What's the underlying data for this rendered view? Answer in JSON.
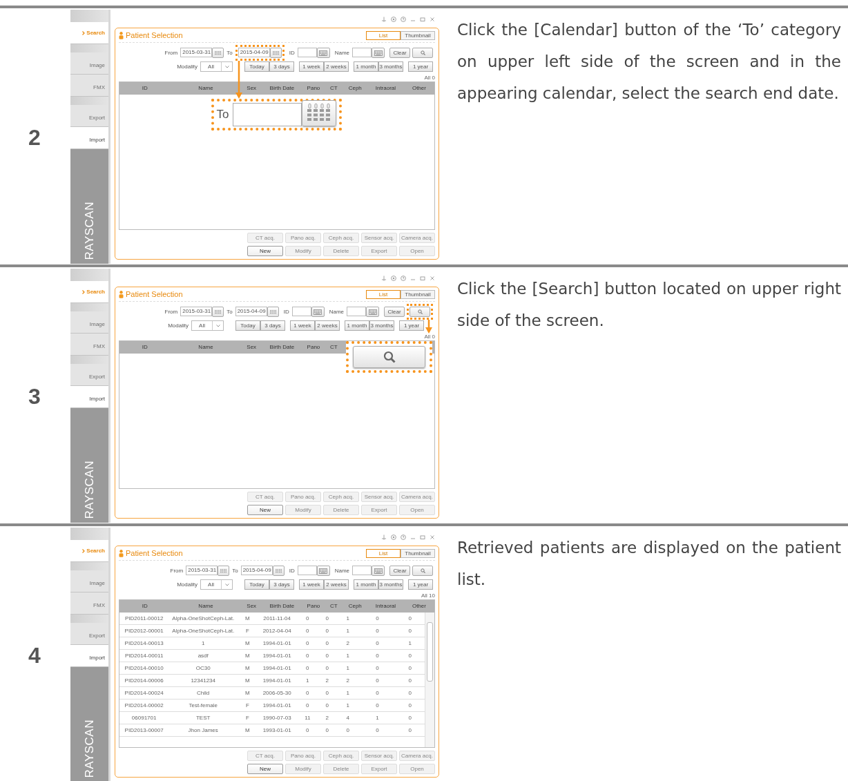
{
  "steps": [
    {
      "number": "2",
      "description": "Click the [Calendar] button of the ‘To’ category on upper left side of the screen and in the appearing calendar, select the search end date.",
      "screen": {
        "sidebar": [
          {
            "label": "Search",
            "selected": true,
            "disabled": false
          },
          {
            "label": "Image",
            "selected": false,
            "disabled": true
          },
          {
            "label": "FMX",
            "selected": false,
            "disabled": true
          },
          {
            "label": "Export",
            "selected": false,
            "disabled": true
          },
          {
            "label": "Import",
            "selected": false,
            "disabled": false
          }
        ],
        "brand": "RAYSCAN",
        "title": "Patient Selection",
        "views": [
          {
            "label": "List",
            "selected": true
          },
          {
            "label": "Thumbnail",
            "selected": false
          }
        ],
        "from_label": "From",
        "from_value": "2015-03-31",
        "to_label": "To",
        "to_value": "2015-04-09",
        "id_label": "ID",
        "name_label": "Name",
        "clear": "Clear",
        "modality_label": "Modality",
        "modality_value": "All",
        "ranges": [
          [
            "Today",
            "3 days"
          ],
          [
            "1 week",
            "2 weeks"
          ],
          [
            "1 month",
            "3 months"
          ],
          [
            "1 year"
          ]
        ],
        "count": "All 0",
        "columns": [
          "ID",
          "Name",
          "Sex",
          "Birth Date",
          "Pano",
          "CT",
          "Ceph",
          "Intraoral",
          "Other"
        ],
        "acq_buttons": [
          {
            "label": "CT acq.",
            "disabled": true
          },
          {
            "label": "Pano acq.",
            "disabled": true
          },
          {
            "label": "Ceph acq.",
            "disabled": true
          },
          {
            "label": "Sensor acq.",
            "disabled": true
          },
          {
            "label": "Camera acq.",
            "disabled": true
          }
        ],
        "action_buttons": [
          {
            "label": "New",
            "disabled": false
          },
          {
            "label": "Modify",
            "disabled": true
          },
          {
            "label": "Delete",
            "disabled": true
          },
          {
            "label": "Export",
            "disabled": true
          },
          {
            "label": "Open",
            "disabled": true
          }
        ],
        "callout": {
          "kind": "date",
          "label": "To"
        }
      }
    },
    {
      "number": "3",
      "description": "Click the [Search] button located on upper right side of the screen.",
      "screen": {
        "sidebar": [
          {
            "label": "Search",
            "selected": true,
            "disabled": false
          },
          {
            "label": "Image",
            "selected": false,
            "disabled": true
          },
          {
            "label": "FMX",
            "selected": false,
            "disabled": true
          },
          {
            "label": "Export",
            "selected": false,
            "disabled": true
          },
          {
            "label": "Import",
            "selected": false,
            "disabled": false
          }
        ],
        "brand": "RAYSCAN",
        "title": "Patient Selection",
        "views": [
          {
            "label": "List",
            "selected": true
          },
          {
            "label": "Thumbnail",
            "selected": false
          }
        ],
        "from_label": "From",
        "from_value": "2015-03-31",
        "to_label": "To",
        "to_value": "2015-04-09",
        "id_label": "ID",
        "name_label": "Name",
        "clear": "Clear",
        "modality_label": "Modality",
        "modality_value": "All",
        "ranges": [
          [
            "Today",
            "3 days"
          ],
          [
            "1 week",
            "2 weeks"
          ],
          [
            "1 month",
            "3 months"
          ],
          [
            "1 year"
          ]
        ],
        "count": "All 0",
        "columns": [
          "ID",
          "Name",
          "Sex",
          "Birth Date",
          "Pano",
          "CT"
        ],
        "acq_buttons": [
          {
            "label": "CT acq.",
            "disabled": true
          },
          {
            "label": "Pano acq.",
            "disabled": true
          },
          {
            "label": "Ceph acq.",
            "disabled": true
          },
          {
            "label": "Sensor acq.",
            "disabled": true
          },
          {
            "label": "Camera acq.",
            "disabled": true
          }
        ],
        "action_buttons": [
          {
            "label": "New",
            "disabled": false
          },
          {
            "label": "Modify",
            "disabled": true
          },
          {
            "label": "Delete",
            "disabled": true
          },
          {
            "label": "Export",
            "disabled": true
          },
          {
            "label": "Open",
            "disabled": true
          }
        ],
        "callout": {
          "kind": "search"
        }
      }
    },
    {
      "number": "4",
      "description": "Retrieved patients are displayed on the patient list.",
      "screen": {
        "sidebar": [
          {
            "label": "Search",
            "selected": true,
            "disabled": false
          },
          {
            "label": "Image",
            "selected": false,
            "disabled": true
          },
          {
            "label": "FMX",
            "selected": false,
            "disabled": true
          },
          {
            "label": "Export",
            "selected": false,
            "disabled": true
          },
          {
            "label": "Import",
            "selected": false,
            "disabled": false
          }
        ],
        "brand": "RAYSCAN",
        "title": "Patient Selection",
        "views": [
          {
            "label": "List",
            "selected": true
          },
          {
            "label": "Thumbnail",
            "selected": false
          }
        ],
        "from_label": "From",
        "from_value": "2015-03-31",
        "to_label": "To",
        "to_value": "2015-04-09",
        "id_label": "ID",
        "name_label": "Name",
        "clear": "Clear",
        "modality_label": "Modality",
        "modality_value": "All",
        "ranges": [
          [
            "Today",
            "3 days"
          ],
          [
            "1 week",
            "2 weeks"
          ],
          [
            "1 month",
            "3 months"
          ],
          [
            "1 year"
          ]
        ],
        "count": "All 10",
        "columns": [
          "ID",
          "Name",
          "Sex",
          "Birth Date",
          "Pano",
          "CT",
          "Ceph",
          "Intraoral",
          "Other"
        ],
        "rows": [
          [
            "PID2011-00012",
            "Alpha-OneShotCeph-Lat.",
            "M",
            "2011-11-04",
            "0",
            "0",
            "1",
            "0",
            "0"
          ],
          [
            "PID2012-00001",
            "Alpha-OneShotCeph-Lat.",
            "F",
            "2012-04-04",
            "0",
            "0",
            "1",
            "0",
            "0"
          ],
          [
            "PID2014-00013",
            "1",
            "M",
            "1994-01-01",
            "0",
            "0",
            "2",
            "0",
            "1"
          ],
          [
            "PID2014-00011",
            "asdf",
            "M",
            "1994-01-01",
            "0",
            "0",
            "1",
            "0",
            "0"
          ],
          [
            "PID2014-00010",
            "OC30",
            "M",
            "1994-01-01",
            "0",
            "0",
            "1",
            "0",
            "0"
          ],
          [
            "PID2014-00006",
            "12341234",
            "M",
            "1994-01-01",
            "1",
            "2",
            "2",
            "0",
            "0"
          ],
          [
            "PID2014-00024",
            "Child",
            "M",
            "2006-05-30",
            "0",
            "0",
            "1",
            "0",
            "0"
          ],
          [
            "PID2014-00002",
            "Test-female",
            "F",
            "1994-01-01",
            "0",
            "0",
            "1",
            "0",
            "0"
          ],
          [
            "06091701",
            "TEST",
            "F",
            "1990-07-03",
            "11",
            "2",
            "4",
            "1",
            "0"
          ],
          [
            "PID2013-00007",
            "Jhon James",
            "M",
            "1993-01-01",
            "0",
            "0",
            "0",
            "0",
            "0"
          ]
        ],
        "acq_buttons": [
          {
            "label": "CT acq.",
            "disabled": true
          },
          {
            "label": "Pano acq.",
            "disabled": true
          },
          {
            "label": "Ceph acq.",
            "disabled": true
          },
          {
            "label": "Sensor acq.",
            "disabled": true
          },
          {
            "label": "Camera acq.",
            "disabled": true
          }
        ],
        "action_buttons": [
          {
            "label": "New",
            "disabled": false
          },
          {
            "label": "Modify",
            "disabled": true
          },
          {
            "label": "Delete",
            "disabled": true
          },
          {
            "label": "Export",
            "disabled": true
          },
          {
            "label": "Open",
            "disabled": true
          }
        ]
      }
    }
  ]
}
